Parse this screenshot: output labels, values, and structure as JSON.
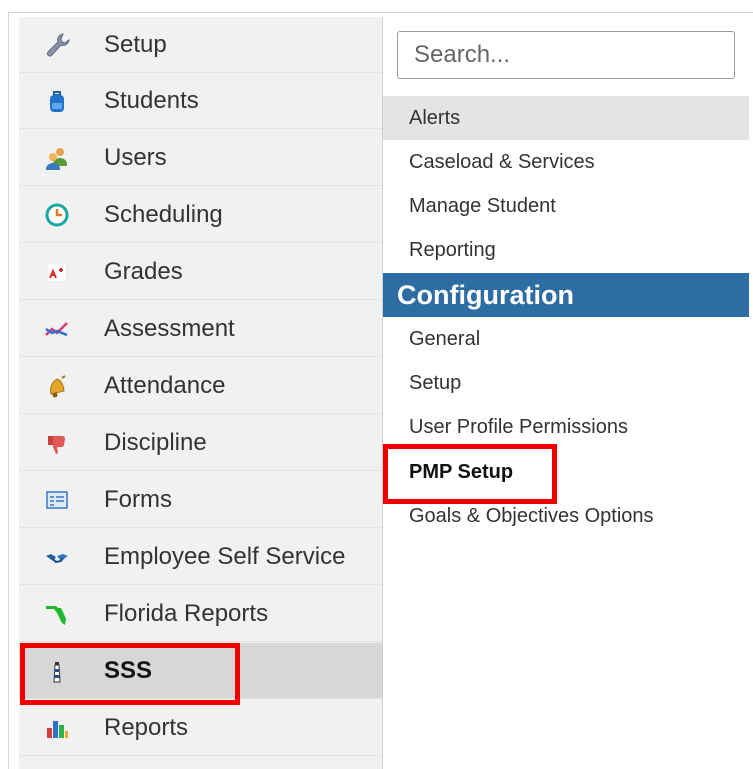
{
  "nav": {
    "items": [
      {
        "label": "Setup",
        "icon": "wrench-icon"
      },
      {
        "label": "Students",
        "icon": "backpack-icon"
      },
      {
        "label": "Users",
        "icon": "users-icon"
      },
      {
        "label": "Scheduling",
        "icon": "clock-icon"
      },
      {
        "label": "Grades",
        "icon": "grades-icon"
      },
      {
        "label": "Assessment",
        "icon": "assessment-icon"
      },
      {
        "label": "Attendance",
        "icon": "bell-icon"
      },
      {
        "label": "Discipline",
        "icon": "thumbs-down-icon"
      },
      {
        "label": "Forms",
        "icon": "form-icon"
      },
      {
        "label": "Employee Self Service",
        "icon": "handshake-icon"
      },
      {
        "label": "Florida Reports",
        "icon": "florida-icon"
      },
      {
        "label": "SSS",
        "icon": "lighthouse-icon",
        "active": true
      },
      {
        "label": "Reports",
        "icon": "bar-chart-icon"
      }
    ]
  },
  "search": {
    "placeholder": "Search..."
  },
  "menu": {
    "top_items": [
      {
        "label": "Alerts",
        "highlighted": true
      },
      {
        "label": "Caseload & Services"
      },
      {
        "label": "Manage Student"
      },
      {
        "label": "Reporting"
      }
    ],
    "section_title": "Configuration",
    "config_items": [
      {
        "label": "General"
      },
      {
        "label": "Setup"
      },
      {
        "label": "User Profile Permissions"
      },
      {
        "label": "PMP Setup",
        "bold": true
      },
      {
        "label": "Goals & Objectives Options"
      }
    ]
  },
  "colors": {
    "section_header": "#2e6da4",
    "annotation": "#ee0000",
    "nav_bg": "#f1f1f1",
    "active_bg": "#d7d7d7"
  }
}
